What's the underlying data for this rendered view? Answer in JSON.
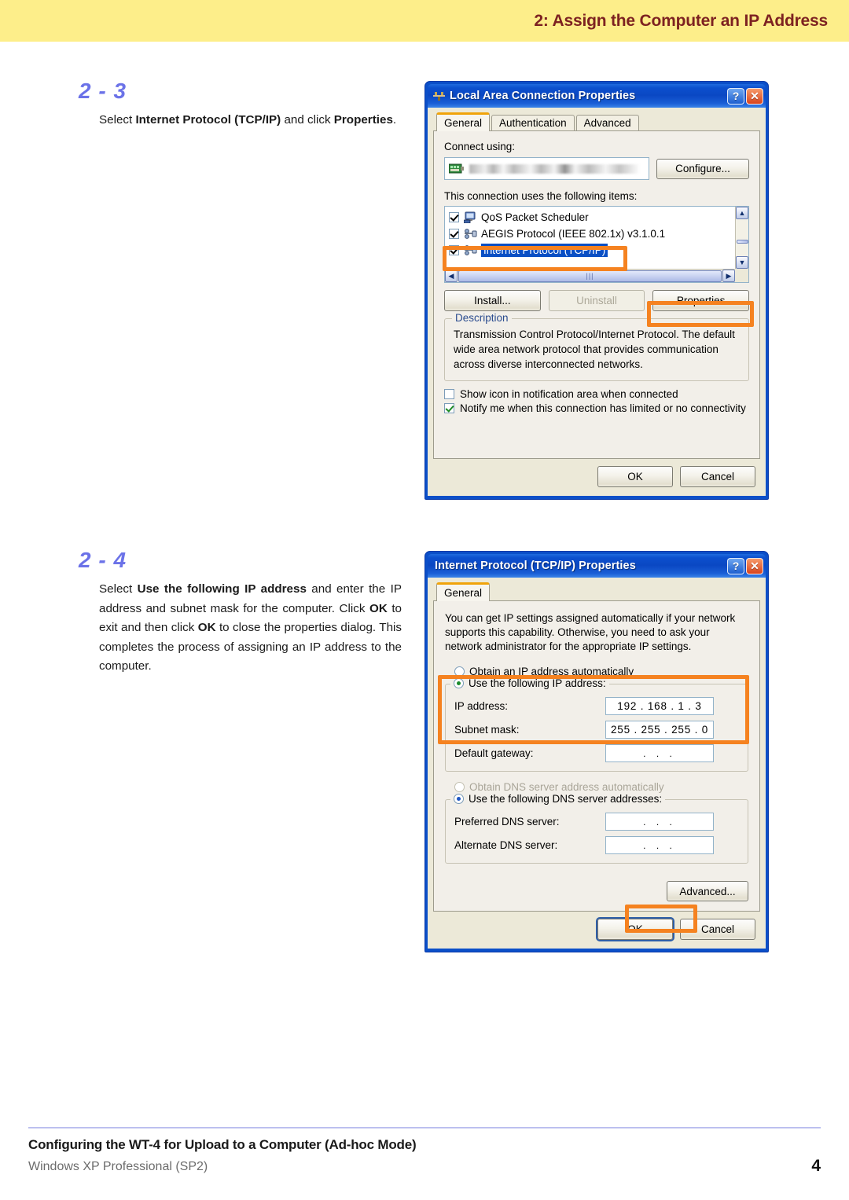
{
  "header": {
    "title": "2: Assign the Computer an IP Address"
  },
  "steps": [
    {
      "number": "2 - 3",
      "text_parts": [
        "Select ",
        "Internet Protocol (TCP/IP)",
        " and click ",
        "Properties",
        "."
      ]
    },
    {
      "number": "2 - 4",
      "text_parts": [
        "Select ",
        "Use the following IP address",
        " and enter the IP address and subnet mask for the computer. Click ",
        "OK",
        " to exit and then click ",
        "OK",
        " to close the properties dialog. This completes the process of assigning an IP address to the computer."
      ]
    }
  ],
  "dialog1": {
    "title": "Local Area Connection Properties",
    "title_icon": "network-connection-icon",
    "help_button": "?",
    "close_button": "✕",
    "tabs": [
      {
        "label": "General",
        "active": true
      },
      {
        "label": "Authentication",
        "active": false
      },
      {
        "label": "Advanced",
        "active": false
      }
    ],
    "connect_using_label": "Connect using:",
    "adapter_name": "",
    "configure_button": "Configure...",
    "items_label": "This connection uses the following items:",
    "items": [
      {
        "label": "QoS Packet Scheduler",
        "checked": true,
        "selected": false,
        "icon": "qos-computer-icon"
      },
      {
        "label": "AEGIS Protocol (IEEE 802.1x) v3.1.0.1",
        "checked": true,
        "selected": false,
        "icon": "protocol-icon"
      },
      {
        "label": "Internet Protocol (TCP/IP)",
        "checked": true,
        "selected": true,
        "icon": "protocol-icon"
      }
    ],
    "buttons": {
      "install": "Install...",
      "uninstall": "Uninstall",
      "properties": "Properties"
    },
    "description_title": "Description",
    "description_text": "Transmission Control Protocol/Internet Protocol. The default wide area network protocol that provides communication across diverse interconnected networks.",
    "checkboxes": [
      {
        "label": "Show icon in notification area when connected",
        "checked": false
      },
      {
        "label": "Notify me when this connection has limited or no connectivity",
        "checked": true
      }
    ],
    "ok_button": "OK",
    "cancel_button": "Cancel"
  },
  "dialog2": {
    "title": "Internet Protocol (TCP/IP) Properties",
    "help_button": "?",
    "close_button": "✕",
    "tabs": [
      {
        "label": "General",
        "active": true
      }
    ],
    "intro_text": "You can get IP settings assigned automatically if your network supports this capability. Otherwise, you need to ask your network administrator for the appropriate IP settings.",
    "radio_auto_ip": "Obtain an IP address automatically",
    "radio_manual_ip": "Use the following IP address:",
    "ip_address_label": "IP address:",
    "ip_address_value": "192 . 168 .  1  .  3",
    "subnet_mask_label": "Subnet mask:",
    "subnet_mask_value": "255 . 255 . 255 .  0",
    "default_gateway_label": "Default gateway:",
    "default_gateway_value": ".    .    .",
    "radio_auto_dns": "Obtain DNS server address automatically",
    "radio_manual_dns": "Use the following DNS server addresses:",
    "preferred_dns_label": "Preferred DNS server:",
    "preferred_dns_value": ".    .    .",
    "alternate_dns_label": "Alternate DNS server:",
    "alternate_dns_value": ".    .    .",
    "advanced_button": "Advanced...",
    "ok_button": "OK",
    "cancel_button": "Cancel"
  },
  "footer": {
    "title": "Configuring the WT-4 for Upload to a Computer (Ad-hoc Mode)",
    "subtitle": "Windows XP Professional (SP2)",
    "page": "4"
  },
  "colors": {
    "header_band": "#fdee8a",
    "header_text": "#7d2221",
    "step_number": "#6b72e8",
    "callout_orange": "#f58220",
    "title_bar_blue": "#0a47c3",
    "selection_blue": "#0a4fc4",
    "footer_rule": "#bcc0ef"
  }
}
